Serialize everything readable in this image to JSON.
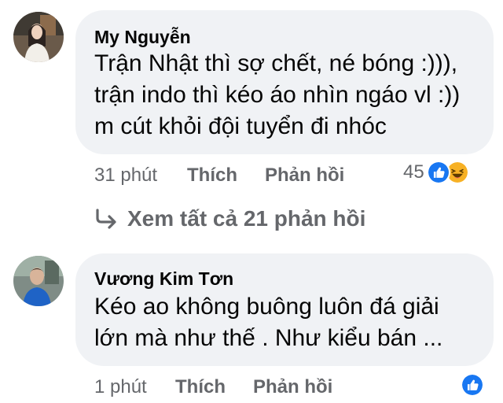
{
  "comments": [
    {
      "author": "My Nguyễn",
      "lines": [
        "Trận Nhật thì sợ chết, né bóng :))),",
        "trận indo thì kéo áo nhìn ngáo vl :))",
        "m cút khỏi đội tuyển đi nhóc"
      ],
      "time": "31 phút",
      "like_label": "Thích",
      "reply_label": "Phản hồi",
      "reaction_count": "45",
      "reactions": [
        "like-icon",
        "haha-icon"
      ]
    },
    {
      "author": "Vương Kim Tơn",
      "lines": [
        "Kéo ao không buông luôn đá giải",
        "lớn mà như thế . Như kiểu bán ..."
      ],
      "time": "1 phút",
      "like_label": "Thích",
      "reply_label": "Phản hồi",
      "reaction_count": "",
      "reactions": [
        "like-icon"
      ]
    }
  ],
  "view_replies": {
    "label": "Xem tất cả 21 phản hồi",
    "icon": "reply-arrow-icon"
  },
  "colors": {
    "bubble": "#f0f2f5",
    "text": "#050505",
    "secondary": "#65676b",
    "like_blue": "#1877f2",
    "haha_yellow": "#f7b125"
  }
}
